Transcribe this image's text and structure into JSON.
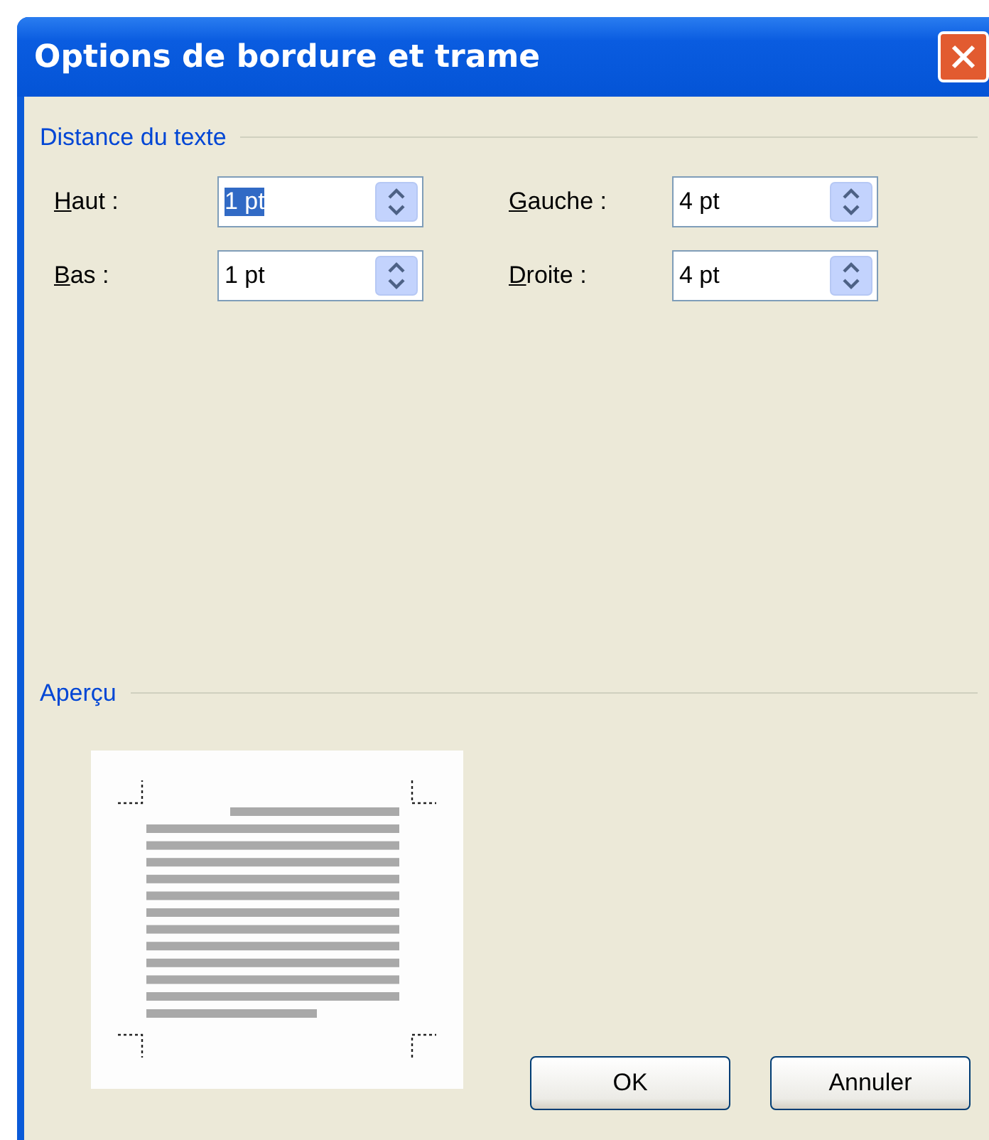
{
  "window": {
    "title": "Options de bordure et trame"
  },
  "distance_section": {
    "title": "Distance du texte",
    "fields": [
      {
        "label": "Haut :",
        "value": "1 pt",
        "selected": true
      },
      {
        "label": "Gauche :",
        "value": "4 pt",
        "selected": false
      },
      {
        "label": "Bas :",
        "value": "1 pt",
        "selected": false
      },
      {
        "label": "Droite :",
        "value": "4 pt",
        "selected": false
      }
    ]
  },
  "preview_section": {
    "title": "Aperçu"
  },
  "buttons": [
    "OK",
    "Annuler"
  ]
}
